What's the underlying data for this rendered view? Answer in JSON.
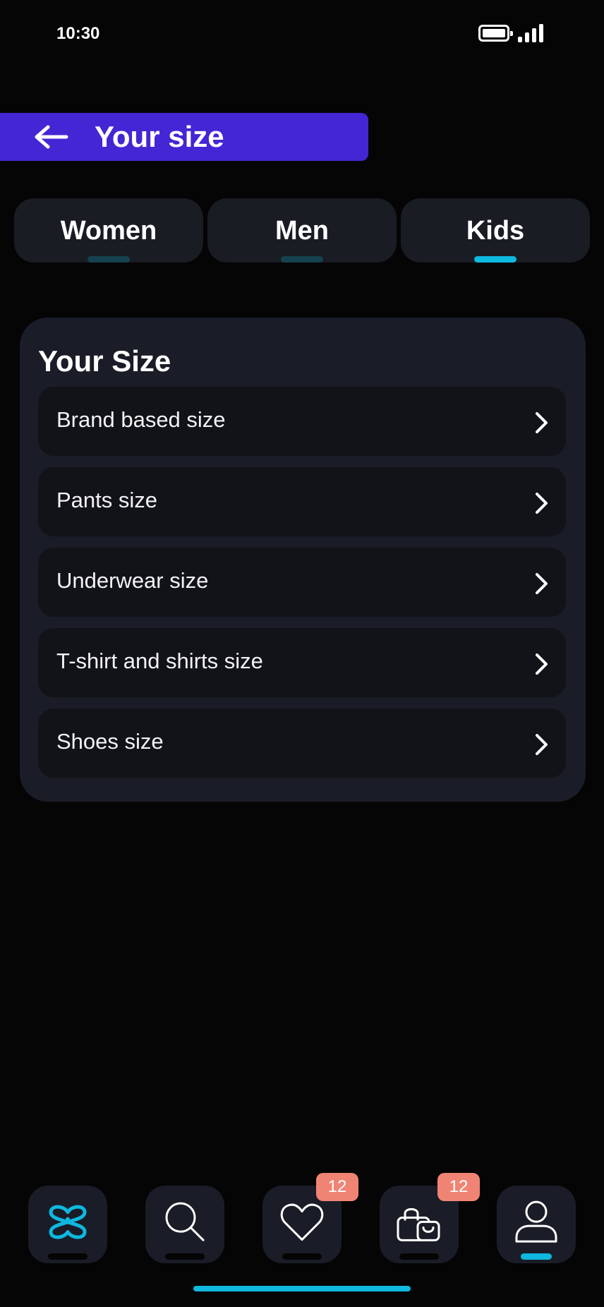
{
  "status_bar": {
    "time": "10:30"
  },
  "header": {
    "title": "Your size"
  },
  "tabs": [
    {
      "label": "Women",
      "active": false
    },
    {
      "label": "Men",
      "active": false
    },
    {
      "label": "Kids",
      "active": true
    }
  ],
  "card": {
    "title": "Your Size",
    "rows": [
      {
        "label": "Brand based size"
      },
      {
        "label": "Pants size"
      },
      {
        "label": "Underwear size"
      },
      {
        "label": "T-shirt and shirts size"
      },
      {
        "label": "Shoes size"
      }
    ]
  },
  "bottom_nav": {
    "items": [
      {
        "icon": "brand-logo-icon"
      },
      {
        "icon": "search-icon"
      },
      {
        "icon": "heart-icon",
        "badge": "12"
      },
      {
        "icon": "shopping-bag-icon",
        "badge": "12"
      },
      {
        "icon": "profile-icon",
        "active": true
      }
    ]
  },
  "colors": {
    "background": "#050506",
    "header": "#4526d4",
    "accent": "#0eb8de",
    "card": "#1a1c27",
    "row": "#121318",
    "badge": "#f08474"
  }
}
